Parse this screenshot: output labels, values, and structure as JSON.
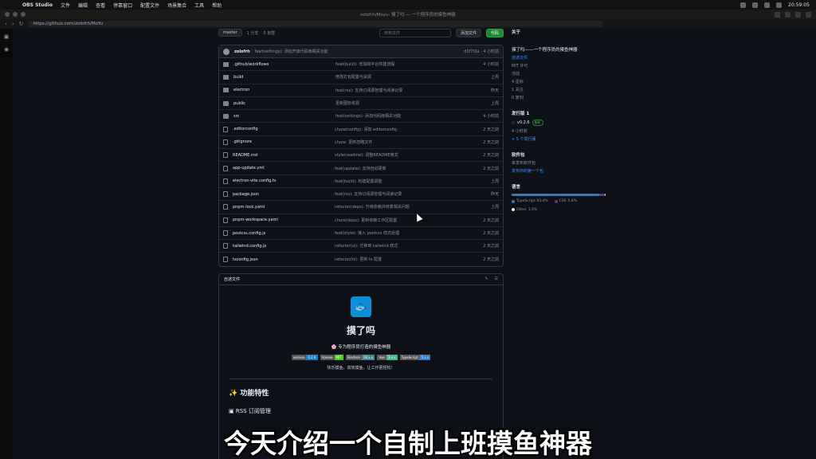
{
  "menubar": {
    "app": "OBS Studio",
    "items": [
      "文件",
      "编辑",
      "查看",
      "停靠窗口",
      "配置文件",
      "场景集合",
      "工具",
      "帮助"
    ],
    "time": "20:59:05"
  },
  "browser": {
    "tab_title": "zolofrh/Moyu: 摸了吗 — 一个程序员的摸鱼神器",
    "url": "https://github.com/zolofrh/MoYu"
  },
  "repo": {
    "branch": "master",
    "branches": "1 分支",
    "tags": "0 标签",
    "search_placeholder": "转到文件",
    "add_file": "添加文件",
    "code": "代码",
    "commit": {
      "author": "zolofrh",
      "message": "feat(settings): 添加开启代码雨相关功能",
      "meta": "d3f7f2a · 4 小时前"
    },
    "files": [
      {
        "name": ".github/workflows",
        "type": "dir",
        "msg": "feat(build): 增加跨平台构建流程",
        "time": "4 小时前"
      },
      {
        "name": "build",
        "type": "dir",
        "msg": "修改打包配置与资源",
        "time": "上周"
      },
      {
        "name": "electron",
        "type": "dir",
        "msg": "feat(rss): 支持订阅源管理与阅读记录",
        "time": "昨天"
      },
      {
        "name": "public",
        "type": "dir",
        "msg": "更新图标资源",
        "time": "上周"
      },
      {
        "name": "src",
        "type": "dir",
        "msg": "feat(settings): 添加代码雨相关功能",
        "time": "4 小时前"
      },
      {
        "name": ".editorconfig",
        "type": "file",
        "msg": "chore(config): 添加 editorconfig",
        "time": "2 天之前"
      },
      {
        "name": ".gitignore",
        "type": "file",
        "msg": "chore: 更新忽略文件",
        "time": "2 天之前"
      },
      {
        "name": "README.md",
        "type": "file",
        "msg": "style(readme): 调整README格式",
        "time": "2 天之前"
      },
      {
        "name": "app-update.yml",
        "type": "file",
        "msg": "feat(update): 支持自动更新",
        "time": "2 天之前"
      },
      {
        "name": "electron-vite.config.ts",
        "type": "file",
        "msg": "feat(build): 构建配置调整",
        "time": "上周"
      },
      {
        "name": "package.json",
        "type": "file",
        "msg": "feat(rss): 支持订阅源管理与阅读记录",
        "time": "昨天"
      },
      {
        "name": "pnpm-lock.yaml",
        "type": "file",
        "msg": "refactor(deps): 升级依赖并修复相关问题",
        "time": "上周"
      },
      {
        "name": "pnpm-workspace.yaml",
        "type": "file",
        "msg": "chore(deps): 更新依赖工作区配置",
        "time": "2 天之前"
      },
      {
        "name": "postcss.config.js",
        "type": "file",
        "msg": "feat(style): 接入 postcss 样式处理",
        "time": "2 天之前"
      },
      {
        "name": "tailwind.config.js",
        "type": "file",
        "msg": "refactor(ui): 迁移到 tailwind 样式",
        "time": "2 天之前"
      },
      {
        "name": "tsconfig.json",
        "type": "file",
        "msg": "refactor(ts): 更新 ts 配置",
        "time": "2 天之前"
      }
    ]
  },
  "readme": {
    "tab": "自述文件",
    "logo": "🐟",
    "title": "摸了吗",
    "subtitle": "🌸 专为程序员打造的摸鱼神器",
    "badges": [
      {
        "l": "version",
        "r": "0.2.6",
        "color": "#0e7fc0"
      },
      {
        "l": "license",
        "r": "MIT",
        "color": "#4c1"
      },
      {
        "l": "Electron",
        "r": "28.x.x",
        "color": "#47848f"
      },
      {
        "l": "Vue",
        "r": "3.x.x",
        "color": "#41b883"
      },
      {
        "l": "TypeScript",
        "r": "5.x.x",
        "color": "#3178c6"
      }
    ],
    "desc": "快乐摸鱼，高效摸鱼，让工作更轻松！",
    "features_heading": "✨ 功能特性",
    "rss_heading": "▣ RSS 订阅管理"
  },
  "about": {
    "heading": "关于",
    "description": "摸了吗——一个程序员的摸鱼神器",
    "readme_link": "自述文件",
    "license": "MIT 许可",
    "activity": "活动",
    "stars": "4 星标",
    "watching": "1 关注",
    "forks": "0 复刻",
    "releases_heading": "发行版 1",
    "release_tag": "v0.2.6",
    "release_latest": "最新",
    "release_time": "4 小时前",
    "more_releases": "+ 5 个发行版",
    "packages_heading": "软件包",
    "packages_none": "未发布软件包",
    "packages_link": "发布你的第一个包",
    "languages_heading": "语言",
    "languages": [
      {
        "name": "TypeScript",
        "pct": "93.4%",
        "color": "#3178c6",
        "share": 0.934
      },
      {
        "name": "CSS",
        "pct": "5.6%",
        "color": "#663399",
        "share": 0.056
      },
      {
        "name": "Other",
        "pct": "1.0%",
        "color": "#ededed",
        "share": 0.01
      }
    ]
  },
  "overlay": {
    "subtitle": "今天介绍一个自制上班摸鱼神器"
  }
}
